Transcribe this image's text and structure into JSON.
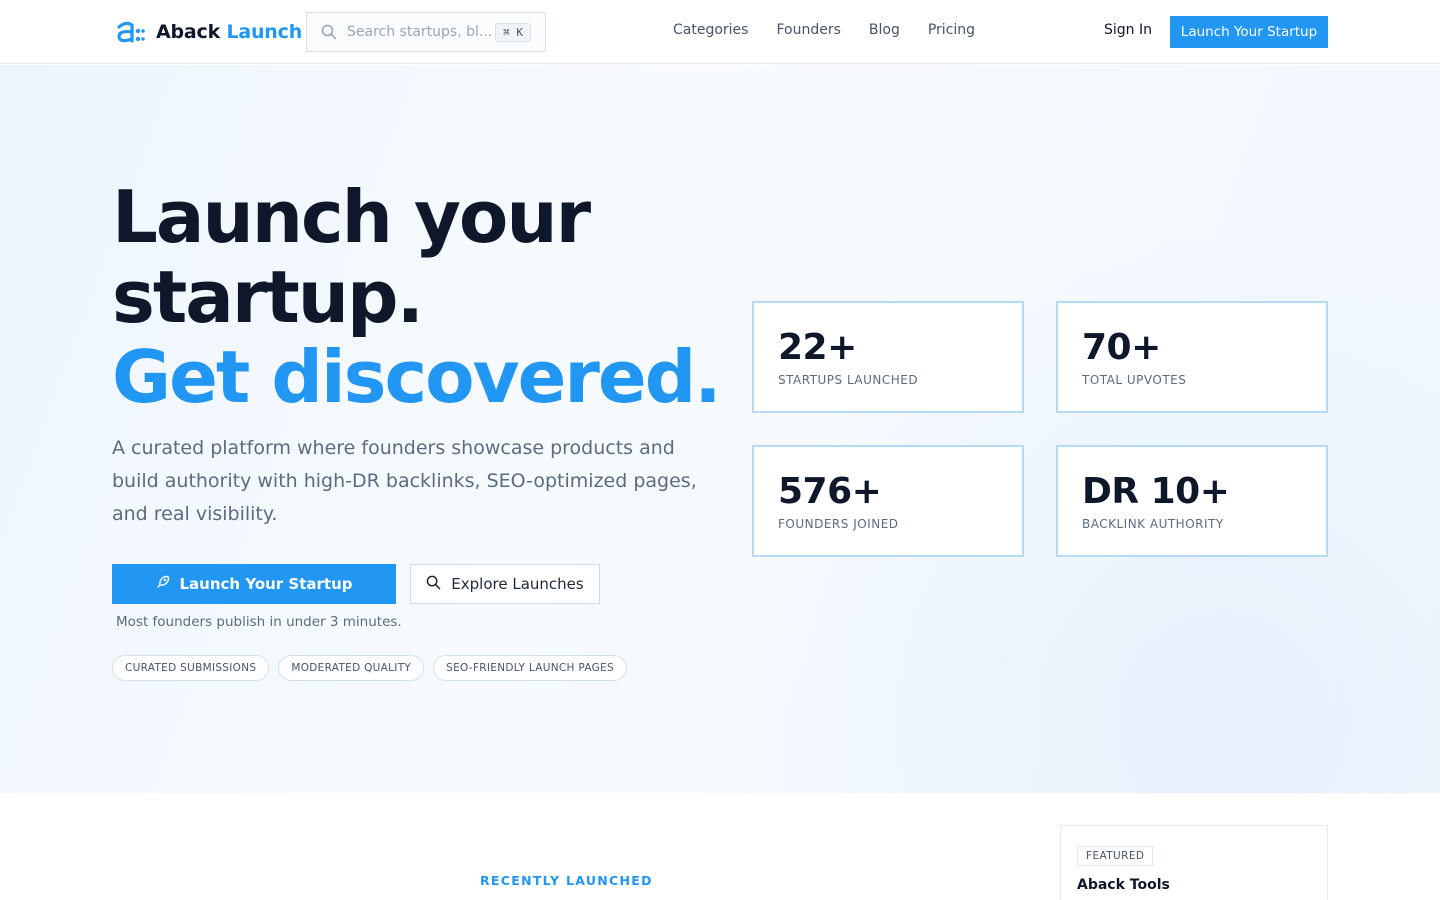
{
  "brand": {
    "name_part1": "Aback",
    "name_part2": "Launch",
    "accent_color": "#2196f3"
  },
  "header": {
    "search_placeholder": "Search startups, bl...",
    "search_shortcut": "⌘ K",
    "nav": [
      "Categories",
      "Founders",
      "Blog",
      "Pricing"
    ],
    "sign_in": "Sign In",
    "cta": "Launch Your Startup"
  },
  "hero": {
    "headline_line1": "Launch your",
    "headline_line2": "startup.",
    "headline_accent": "Get discovered.",
    "subtitle": "A curated platform where founders showcase products and build authority with high-DR backlinks, SEO-optimized pages, and real visibility.",
    "primary_button": "Launch Your Startup",
    "secondary_button": "Explore Launches",
    "note": "Most founders publish in under 3 minutes.",
    "tags": [
      "CURATED SUBMISSIONS",
      "MODERATED QUALITY",
      "SEO-FRIENDLY LAUNCH PAGES"
    ],
    "stats": [
      {
        "value": "22+",
        "label": "STARTUPS LAUNCHED"
      },
      {
        "value": "70+",
        "label": "TOTAL UPVOTES"
      },
      {
        "value": "576+",
        "label": "FOUNDERS JOINED"
      },
      {
        "value": "DR 10+",
        "label": "BACKLINK AUTHORITY"
      }
    ]
  },
  "sections": {
    "recently_launched": "RECENTLY LAUNCHED",
    "featured_badge": "FEATURED",
    "featured_title": "Aback Tools"
  },
  "icons": {
    "logo": "aback-logo-icon",
    "search": "search-icon",
    "rocket": "rocket-icon"
  }
}
